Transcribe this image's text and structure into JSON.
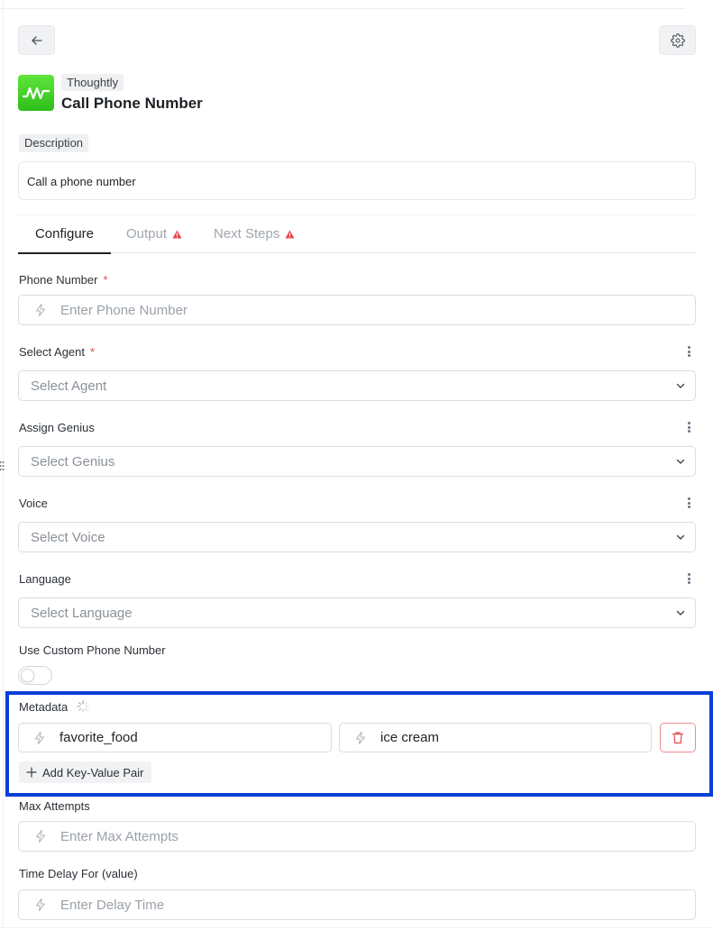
{
  "header": {
    "app_tag": "Thoughtly",
    "title": "Call Phone Number",
    "back_icon": "arrow-left-icon",
    "settings_icon": "gear-icon"
  },
  "description": {
    "label": "Description",
    "value": "Call a phone number"
  },
  "tabs": [
    {
      "label": "Configure",
      "active": true
    },
    {
      "label": "Output",
      "warning": true
    },
    {
      "label": "Next Steps",
      "warning": true
    }
  ],
  "fields": {
    "phone_number": {
      "label": "Phone Number",
      "required": "*",
      "placeholder": "Enter Phone Number"
    },
    "agent": {
      "label": "Select Agent",
      "required": "*",
      "placeholder": "Select Agent"
    },
    "genius": {
      "label": "Assign Genius",
      "placeholder": "Select Genius"
    },
    "voice": {
      "label": "Voice",
      "placeholder": "Select Voice"
    },
    "language": {
      "label": "Language",
      "placeholder": "Select Language"
    },
    "custom_phone": {
      "label": "Use Custom Phone Number",
      "enabled": false
    },
    "metadata": {
      "label": "Metadata",
      "pairs": [
        {
          "key": "favorite_food",
          "value": "ice cream"
        }
      ],
      "add_label": "Add Key-Value Pair"
    },
    "max_attempts": {
      "label": "Max Attempts",
      "placeholder": "Enter Max Attempts"
    },
    "time_delay": {
      "label": "Time Delay For (value)",
      "placeholder": "Enter Delay Time"
    }
  },
  "colors": {
    "highlight": "#0a3fd6",
    "required": "#e5484d",
    "warning": "#e5484d",
    "brand": "#3ccf23"
  }
}
